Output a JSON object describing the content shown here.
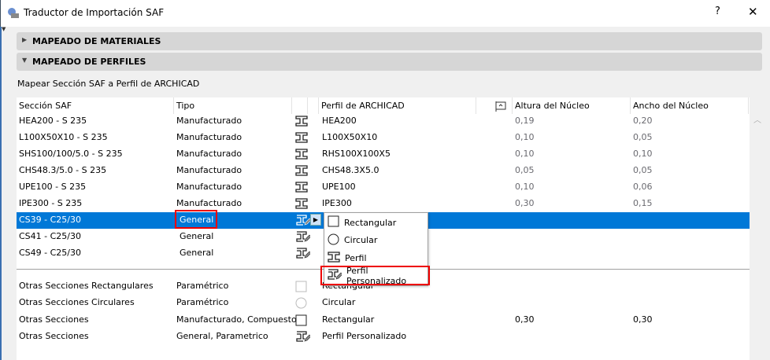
{
  "window": {
    "title": "Traductor de Importación SAF",
    "help": "?",
    "close": "✕"
  },
  "sections": [
    {
      "label": "MAPEADO DE MATERIALES",
      "expanded": false
    },
    {
      "label": "MAPEADO DE PERFILES",
      "expanded": true
    }
  ],
  "subtitle": "Mapear Sección SAF a Perfil de ARCHICAD",
  "columns": {
    "seccion": "Sección SAF",
    "tipo": "Tipo",
    "perfil": "Perfil de ARCHICAD",
    "altura": "Altura del Núcleo",
    "ancho": "Ancho del Núcleo"
  },
  "rows": [
    {
      "seccion": "HEA200 - S 235",
      "tipo": "Manufacturado",
      "icon": "ibeam",
      "perfil": "HEA200",
      "altura": "0,19",
      "ancho": "0,20"
    },
    {
      "seccion": "L100X50X10 - S 235",
      "tipo": "Manufacturado",
      "icon": "ibeam",
      "perfil": "L100X50X10",
      "altura": "0,10",
      "ancho": "0,05"
    },
    {
      "seccion": "SHS100/100/5.0 - S 235",
      "tipo": "Manufacturado",
      "icon": "ibeam",
      "perfil": "RHS100X100X5",
      "altura": "0,10",
      "ancho": "0,10"
    },
    {
      "seccion": "CHS48.3/5.0 - S 235",
      "tipo": "Manufacturado",
      "icon": "ibeam",
      "perfil": "CHS48.3X5.0",
      "altura": "0,05",
      "ancho": "0,05"
    },
    {
      "seccion": "UPE100 - S 235",
      "tipo": "Manufacturado",
      "icon": "ibeam",
      "perfil": "UPE100",
      "altura": "0,10",
      "ancho": "0,06"
    },
    {
      "seccion": "IPE300 - S 235",
      "tipo": "Manufacturado",
      "icon": "ibeam",
      "perfil": "IPE300",
      "altura": "0,30",
      "ancho": "0,15"
    },
    {
      "seccion": "CS39 - C25/30",
      "tipo": "General",
      "icon": "custom",
      "perfil": "",
      "altura": "",
      "ancho": "",
      "selected": true
    },
    {
      "seccion": "CS41 - C25/30",
      "tipo": "General",
      "icon": "custom",
      "perfil": "",
      "altura": "",
      "ancho": ""
    },
    {
      "seccion": "CS49 - C25/30",
      "tipo": "General",
      "icon": "custom",
      "perfil": "",
      "altura": "",
      "ancho": ""
    }
  ],
  "other_rows": [
    {
      "seccion": "Otras Secciones Rectangulares",
      "tipo": "Paramétrico",
      "icon": "square-gray",
      "perfil": "Rectangular",
      "altura": "",
      "ancho": ""
    },
    {
      "seccion": "Otras Secciones Circulares",
      "tipo": "Paramétrico",
      "icon": "circle-gray",
      "perfil": "Circular",
      "altura": "",
      "ancho": ""
    },
    {
      "seccion": "Otras Secciones",
      "tipo": "Manufacturado, Compuesto",
      "icon": "square",
      "perfil": "Rectangular",
      "altura": "0,30",
      "ancho": "0,30"
    },
    {
      "seccion": "Otras Secciones",
      "tipo": "General, Parametrico",
      "icon": "custom",
      "perfil": "Perfil Personalizado",
      "altura": "",
      "ancho": ""
    }
  ],
  "popup_menu": [
    {
      "label": "Rectangular",
      "icon": "square"
    },
    {
      "label": "Circular",
      "icon": "circle"
    },
    {
      "label": "Perfil",
      "icon": "ibeam"
    },
    {
      "label": "Perfil Personalizado",
      "icon": "custom",
      "highlighted": true
    }
  ],
  "colors": {
    "selection": "#0078d7",
    "highlight_box": "#ee0000"
  }
}
